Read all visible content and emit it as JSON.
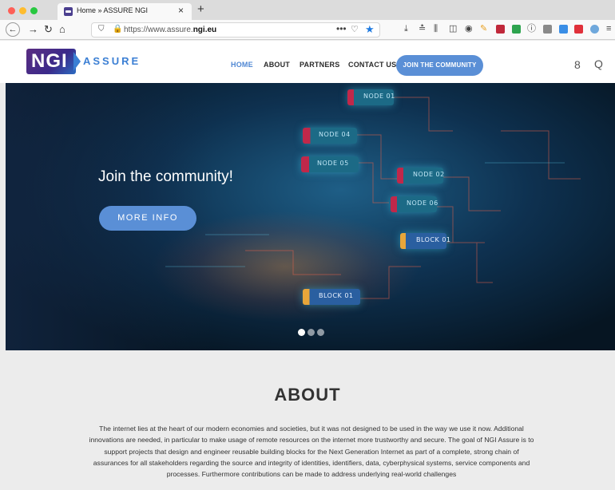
{
  "browser": {
    "tab_title": "Home » ASSURE NGI",
    "tab_close": "×",
    "new_tab": "+",
    "url_prefix": "https://www.assure.",
    "url_domain": "ngi.eu",
    "url_more": "•••",
    "icons": {
      "back": "back-arrow-icon",
      "forward": "forward-arrow-icon",
      "reload": "reload-icon",
      "home": "home-icon"
    }
  },
  "site": {
    "logo_main": "NGI",
    "logo_sub": "ASSURE",
    "menu": {
      "home": "HOME",
      "about": "ABOUT",
      "partners": "PARTNERS",
      "contact": "CONTACT US",
      "cta": "JOIN THE COMMUNITY"
    }
  },
  "hero": {
    "title": "Join the community!",
    "button": "MORE INFO",
    "nodes": [
      "NODE 01",
      "NODE 04",
      "NODE 05",
      "NODE 02",
      "NODE 06",
      "BLOCK 01",
      "BLOCK 01"
    ],
    "slides": 3,
    "active_slide": 1
  },
  "about": {
    "title": "ABOUT",
    "text": "The internet lies at the heart of our modern economies and societies, but it was not designed to be used in the way we use it now. Additional innovations are needed, in particular to make usage of remote resources on the internet more trustworthy and secure. The goal of NGI Assure is to support projects that design and engineer reusable building blocks for the Next Generation Internet as part of a complete, strong chain of assurances for all stakeholders regarding the source and integrity of identities, identifiers, data, cyberphysical systems, service components and processes. Furthermore contributions can be made to address underlying real-world challenges"
  },
  "colors": {
    "accent": "#5a8fd6",
    "logo_purple": "#5a2d82",
    "logo_blue": "#3b7fd4"
  }
}
